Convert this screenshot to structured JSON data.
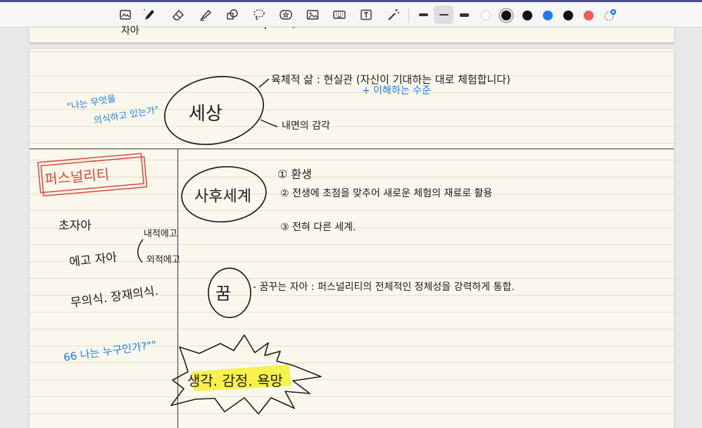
{
  "toolbar": {
    "tools": [
      {
        "name": "image-scan-tool",
        "icon": "image-frame-icon"
      },
      {
        "name": "pen-tool",
        "icon": "pen-icon",
        "active": true
      },
      {
        "name": "eraser-tool",
        "icon": "eraser-icon"
      },
      {
        "name": "highlighter-tool",
        "icon": "highlighter-icon"
      },
      {
        "name": "shapes-tool",
        "icon": "shapes-icon"
      },
      {
        "name": "lasso-tool",
        "icon": "lasso-icon"
      },
      {
        "name": "sticker-tool",
        "icon": "star-sticker-icon"
      },
      {
        "name": "image-tool",
        "icon": "picture-icon"
      },
      {
        "name": "keyboard-tool",
        "icon": "keyboard-icon"
      },
      {
        "name": "text-tool",
        "icon": "text-box-icon"
      },
      {
        "name": "laser-pointer-tool",
        "icon": "laser-wand-icon"
      }
    ],
    "pen_sizes": [
      "thin",
      "medium",
      "thick"
    ],
    "active_pen_size": "medium",
    "colors": [
      "#ffffff",
      "#111111",
      "#111111",
      "#1a7cf0",
      "#111111",
      "#ef5a5a"
    ],
    "active_color_index": 1
  },
  "note": {
    "cue_column": {
      "blue_quote_1_line1": "\"나는 무엇을",
      "blue_quote_1_line2": "의식하고 있는가\"",
      "red_box_label": "퍼스널리티",
      "label_1": "초자아",
      "label_2": "에고 자아",
      "label_2a": "내적에고",
      "label_2b": "외적에고",
      "label_3": "무의식. 장재의식.",
      "blue_quote_2": "66 나는 누구인가?\"\""
    },
    "main": {
      "circle_1": "세상",
      "line_1": "육체적 삶 : 현실관 (자신이 기대하는 대로 체험합니다)",
      "line_1_blue": "+ 이해하는 수준",
      "line_2": "내면의 감각",
      "circle_2": "사후세계",
      "item_1": "① 환생",
      "item_2": "② 전생에 초점을 맞추어 새로운 체험의 재료로 활용",
      "item_3": "③ 전혀 다른 세계.",
      "circle_3": "꿈",
      "line_3": "- 꿈꾸는 자아 : 퍼스널리티의 전체적인 정체성을 강력하게 통합.",
      "burst_text": "생각. 감정. 욕망"
    },
    "prev_page_partial": [
      "자아",
      "・",
      "-"
    ]
  },
  "colors": {
    "ink_black": "#1c1c1c",
    "ink_blue": "#1a7cf0",
    "ink_red": "#e0453f",
    "highlight_yellow": "#f6ef3c",
    "paper": "#faf8ec"
  }
}
